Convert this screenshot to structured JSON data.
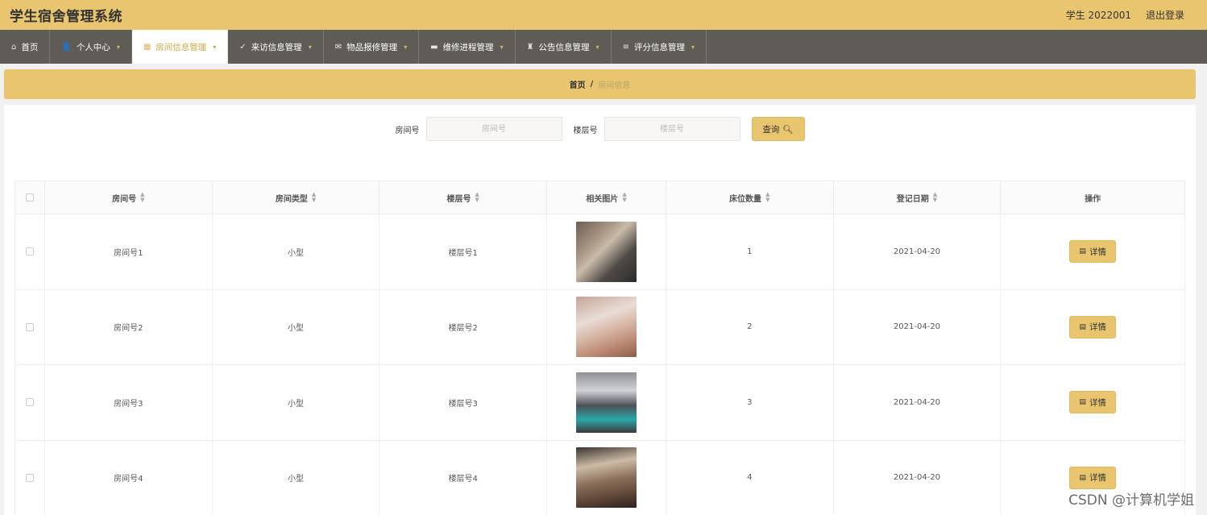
{
  "header": {
    "title": "学生宿舍管理系统",
    "user": "学生 2022001",
    "logout": "退出登录"
  },
  "nav": [
    {
      "label": "首页",
      "icon": "home-icon",
      "glyph": "⌂",
      "active": false,
      "dropdown": false
    },
    {
      "label": "个人中心",
      "icon": "user-icon",
      "glyph": "👤",
      "active": false,
      "dropdown": true
    },
    {
      "label": "房间信息管理",
      "icon": "grid-icon",
      "glyph": "▦",
      "active": true,
      "dropdown": true
    },
    {
      "label": "来访信息管理",
      "icon": "check-circle-icon",
      "glyph": "✓",
      "active": false,
      "dropdown": true
    },
    {
      "label": "物品报修管理",
      "icon": "mail-icon",
      "glyph": "✉",
      "active": false,
      "dropdown": true
    },
    {
      "label": "维修进程管理",
      "icon": "video-icon",
      "glyph": "▬",
      "active": false,
      "dropdown": true
    },
    {
      "label": "公告信息管理",
      "icon": "trophy-icon",
      "glyph": "♜",
      "active": false,
      "dropdown": true
    },
    {
      "label": "评分信息管理",
      "icon": "list-icon",
      "glyph": "≡",
      "active": false,
      "dropdown": true
    }
  ],
  "breadcrumb": {
    "home": "首页",
    "separator": "/",
    "current": "房间信息"
  },
  "search": {
    "room_label": "房间号",
    "room_placeholder": "房间号",
    "floor_label": "楼层号",
    "floor_placeholder": "楼层号",
    "query_button": "查询"
  },
  "table": {
    "columns": [
      "房间号",
      "房间类型",
      "楼层号",
      "相关图片",
      "床位数量",
      "登记日期",
      "操作"
    ],
    "rows": [
      {
        "room": "房间号1",
        "type": "小型",
        "floor": "楼层号1",
        "beds": "1",
        "date": "2021-04-20",
        "action": "详情"
      },
      {
        "room": "房间号2",
        "type": "小型",
        "floor": "楼层号2",
        "beds": "2",
        "date": "2021-04-20",
        "action": "详情"
      },
      {
        "room": "房间号3",
        "type": "小型",
        "floor": "楼层号3",
        "beds": "3",
        "date": "2021-04-20",
        "action": "详情"
      },
      {
        "room": "房间号4",
        "type": "小型",
        "floor": "楼层号4",
        "beds": "4",
        "date": "2021-04-20",
        "action": "详情"
      }
    ]
  },
  "watermark": "CSDN @计算机学姐",
  "colors": {
    "accent": "#e8c56e",
    "nav_bg": "#5f5c58",
    "active_text": "#d4a849"
  }
}
